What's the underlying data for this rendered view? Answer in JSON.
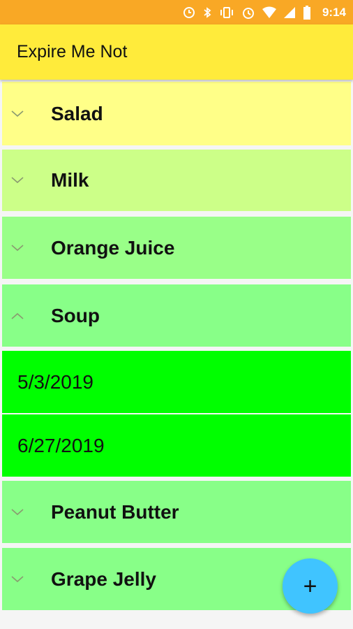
{
  "status_bar": {
    "time": "9:14",
    "icons": [
      "sync-icon",
      "bluetooth-icon",
      "vibrate-icon",
      "alarm-icon",
      "wifi-icon",
      "signal-icon",
      "battery-icon"
    ]
  },
  "app_bar": {
    "title": "Expire Me Not"
  },
  "list": {
    "items": [
      {
        "label": "Salad",
        "color": "#ffff88",
        "expanded": false
      },
      {
        "label": "Milk",
        "color": "#ccff88",
        "expanded": false
      },
      {
        "label": "Orange Juice",
        "color": "#99ff88",
        "expanded": false
      },
      {
        "label": "Soup",
        "color": "#88ff88",
        "expanded": true,
        "dates": [
          "5/3/2019",
          "6/27/2019"
        ]
      },
      {
        "label": "Peanut Butter",
        "color": "#88ff88",
        "expanded": false
      },
      {
        "label": "Grape Jelly",
        "color": "#88ff88",
        "expanded": false
      }
    ]
  },
  "fab": {
    "label": "+"
  }
}
